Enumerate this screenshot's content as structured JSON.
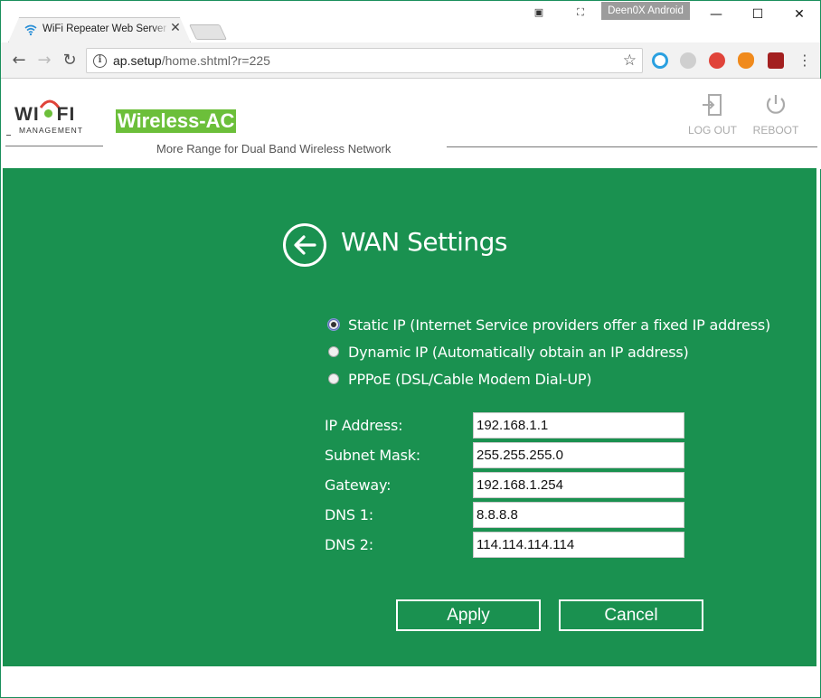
{
  "browser": {
    "tab": {
      "title": "WiFi Repeater Web Server"
    },
    "profile_name": "Deen0X Android",
    "address": {
      "host": "ap.setup",
      "path": "/home.shtml?r=225"
    }
  },
  "header": {
    "logo": {
      "word_left": "WI",
      "word_right": "FI",
      "sub": "MANAGEMENT"
    },
    "brand": "Wireless-AC",
    "tagline": "More Range for Dual Band Wireless Network",
    "logout_label": "LOG OUT",
    "reboot_label": "REBOOT"
  },
  "panel": {
    "title": "WAN Settings",
    "modes": [
      {
        "label": "Static IP (Internet Service providers offer a fixed IP address)",
        "checked": true
      },
      {
        "label": "Dynamic IP (Automatically obtain an IP address)",
        "checked": false
      },
      {
        "label": "PPPoE (DSL/Cable Modem Dial-UP)",
        "checked": false
      }
    ],
    "fields": [
      {
        "label": "IP Address:",
        "value": "192.168.1.1"
      },
      {
        "label": "Subnet Mask:",
        "value": "255.255.255.0"
      },
      {
        "label": "Gateway:",
        "value": "192.168.1.254"
      },
      {
        "label": "DNS 1:",
        "value": "8.8.8.8"
      },
      {
        "label": "DNS 2:",
        "value": "114.114.114.114"
      }
    ],
    "apply_label": "Apply",
    "cancel_label": "Cancel"
  },
  "colors": {
    "panel_green": "#1a9150",
    "brand_green": "#6cbf3a",
    "white": "#ffffff"
  }
}
